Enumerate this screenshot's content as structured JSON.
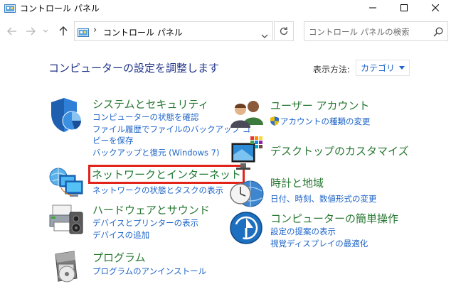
{
  "window": {
    "title": "コントロール パネル",
    "icon": "control-panel-icon"
  },
  "nav": {
    "address_separator": "›",
    "address_path": "コントロール パネル",
    "search_placeholder": "コントロール パネルの検索"
  },
  "header": {
    "heading": "コンピューターの設定を調整します",
    "view_by_label": "表示方法:",
    "view_by_value": "カテゴリ"
  },
  "categories": {
    "system": {
      "title": "システムとセキュリティ",
      "icon": "system-security-shield-icon",
      "links": [
        "コンピューターの状態を確認",
        "ファイル履歴でファイルのバックアップ コ",
        "ピーを保存",
        "バックアップと復元 (Windows 7)"
      ]
    },
    "network": {
      "title": "ネットワークとインターネット",
      "icon": "network-monitors-globe-icon",
      "highlight_color": "#e2231a",
      "links": [
        "ネットワークの状態とタスクの表示"
      ]
    },
    "hardware": {
      "title": "ハードウェアとサウンド",
      "icon": "printer-speaker-icon",
      "links": [
        "デバイスとプリンターの表示",
        "デバイスの追加"
      ]
    },
    "programs": {
      "title": "プログラム",
      "icon": "program-box-disc-icon",
      "links": [
        "プログラムのアンインストール"
      ]
    },
    "user": {
      "title": "ユーザー アカウント",
      "icon": "users-icon",
      "links": [
        "アカウントの種類の変更"
      ]
    },
    "appearance": {
      "title": "デスクトップのカスタマイズ",
      "icon": "monitor-palette-icon",
      "links": []
    },
    "clock": {
      "title": "時計と地域",
      "icon": "clock-globe-icon",
      "links": [
        "日付、時刻、数値形式の変更"
      ]
    },
    "ease": {
      "title": "コンピューターの簡単操作",
      "icon": "ease-of-access-icon",
      "links": [
        "設定の提案の表示",
        "視覚ディスプレイの最適化"
      ]
    }
  },
  "colors": {
    "category_title": "#287832",
    "link": "#1e64c8",
    "heading": "#1e3287",
    "highlight_border": "#e2231a"
  }
}
